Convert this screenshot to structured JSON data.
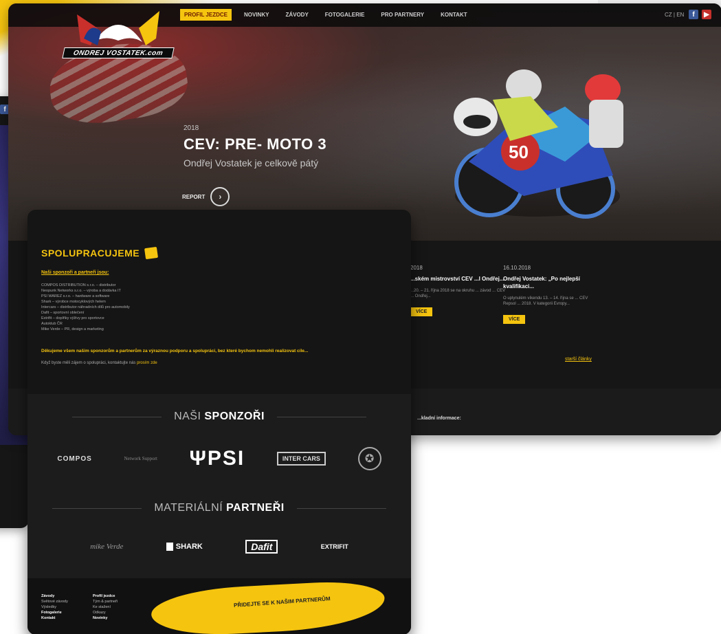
{
  "nav": {
    "items": [
      "PROFIL JEZDCE",
      "NOVINKY",
      "ZÁVODY",
      "FOTOGALERIE",
      "PRO PARTNERY",
      "KONTAKT"
    ],
    "active_index": 0,
    "lang": "CZ | EN"
  },
  "logo": {
    "text": "ONDREJ VOSTATEK.com"
  },
  "hero": {
    "year": "2018",
    "title": "CEV: PRE- MOTO 3",
    "subtitle": "Ondřej Vostatek je celkově pátý",
    "report_label": "REPORT"
  },
  "news": [
    {
      "date": "2018",
      "title": "...ském mistrovství CEV ...l Ondřej...",
      "text": "...20. – 21. října 2018 se na okruhu ... závod ... CEV ... Ondřej...",
      "more": "VÍCE"
    },
    {
      "date": "16.10.2018",
      "title": "Ondřej Vostatek: „Po nejlepší kvalifikaci...",
      "text": "O uplynulém víkendu 13. – 14. října se ... CEV Repsol ... 2018. V kategorii Evropy...",
      "more": "VÍCE"
    }
  ],
  "older_link": "starší články",
  "basic_info": "...kladní informace:",
  "partners": {
    "title": "SPOLUPRACUJEME",
    "subtitle": "Naši sponzoři a partneři jsou:",
    "list": [
      "COMPOS DISTRIBUTION s.r.o. – distributor",
      "Neopunk Networks s.r.o. – výroba a dodávka IT",
      "PSI WAREZ s.r.o. – hardware a software",
      "Shark – výrobce motocyklových helem",
      "Intercars – distributor náhradních dílů pro automobily",
      "Dafit – sportovní oblečení",
      "Extrifit – doplňky výživy pro sportovce",
      "Autoklub ČR",
      "Mike Verde – PR, design a marketing"
    ],
    "thanks": "Děkujeme všem našim sponzorům a partnerům za výraznou podporu a spolupráci, bez které bychom nemohli realizovat cíle...",
    "invite": "Když byste měli zájem o spolupráci, kontaktujte nás",
    "invite_link": "prosím zde"
  },
  "sponsors": {
    "title_light": "NAŠI",
    "title_bold": "SPONZOŘI",
    "logos": [
      "COMPOS",
      "Network Support",
      "ΨPSI",
      "INTER CARS"
    ]
  },
  "material": {
    "title_light": "MATERIÁLNÍ",
    "title_bold": "PARTNEŘI",
    "logos": [
      "mike Verde",
      "SHARK",
      "Dafit",
      "EXTRIFIT"
    ]
  },
  "footer": {
    "col1": [
      "Závody",
      "Světové závody",
      "Výsledky",
      "Fotogalerie",
      "Kontakt"
    ],
    "col2": [
      "Profil jezdce",
      "Tým & partneři",
      "Ke stažení",
      "Odkazy",
      "Novinky"
    ],
    "splash": "PŘIDEJTE SE K NAŠIM PARTNERŮM"
  },
  "colors": {
    "accent": "#f5c40f",
    "bg": "#151515",
    "facebook": "#3b5998",
    "youtube": "#c4302b"
  }
}
